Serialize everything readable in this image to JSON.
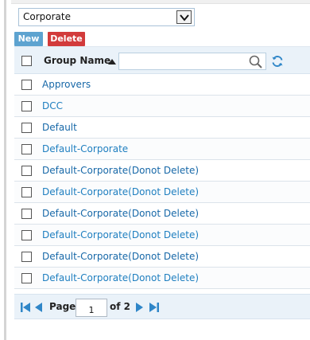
{
  "group_select": {
    "selected": "Corporate"
  },
  "toolbar": {
    "new_label": "New",
    "delete_label": "Delete"
  },
  "grid": {
    "column_header": "Group Name",
    "filter_value": "",
    "rows": [
      {
        "name": "Approvers"
      },
      {
        "name": "DCC"
      },
      {
        "name": "Default"
      },
      {
        "name": "Default-Corporate"
      },
      {
        "name": "Default-Corporate(Donot Delete)"
      },
      {
        "name": "Default-Corporate(Donot Delete)"
      },
      {
        "name": "Default-Corporate(Donot Delete)"
      },
      {
        "name": "Default-Corporate(Donot Delete)"
      },
      {
        "name": "Default-Corporate(Donot Delete)"
      },
      {
        "name": "Default-Corporate(Donot Delete)"
      }
    ]
  },
  "pager": {
    "page_label": "Page",
    "current_page": "1",
    "of_label": "of 2"
  },
  "colors": {
    "link": "#1f7fc0",
    "new_button": "#5da3d0",
    "delete_button": "#d23b3b",
    "header_bg": "#eaf2f9"
  }
}
